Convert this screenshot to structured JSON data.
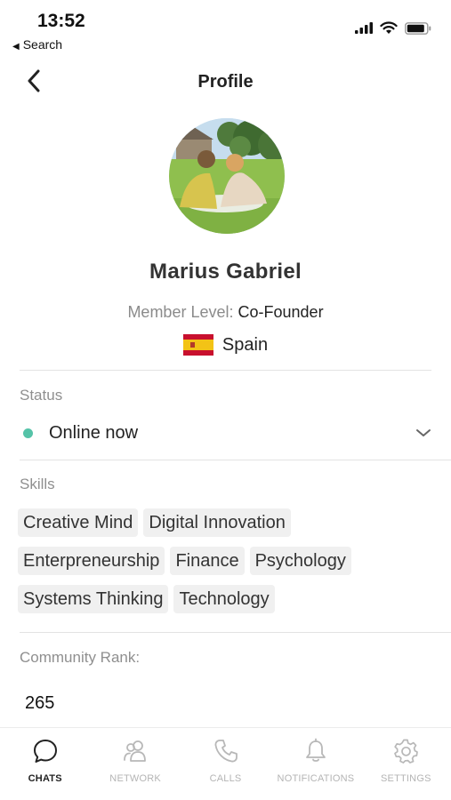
{
  "status_bar": {
    "time": "13:52",
    "back_app": "Search"
  },
  "nav": {
    "title": "Profile"
  },
  "profile": {
    "name": "Marius Gabriel",
    "member_level_label": "Member Level:",
    "member_level_value": "Co-Founder",
    "country": "Spain"
  },
  "status": {
    "label": "Status",
    "value": "Online now",
    "color": "#55c3a8"
  },
  "skills": {
    "label": "Skills",
    "items": [
      "Creative Mind",
      "Digital Innovation",
      "Enterpreneurship",
      "Finance",
      "Psychology",
      "Systems Thinking",
      "Technology"
    ]
  },
  "community": {
    "label": "Community Rank:",
    "value": "265"
  },
  "tabs": [
    {
      "label": "CHATS",
      "icon": "chat-bubble-icon",
      "active": true
    },
    {
      "label": "NETWORK",
      "icon": "network-icon",
      "active": false
    },
    {
      "label": "CALLS",
      "icon": "phone-icon",
      "active": false
    },
    {
      "label": "NOTIFICATIONS",
      "icon": "bell-icon",
      "active": false
    },
    {
      "label": "SETTINGS",
      "icon": "gear-icon",
      "active": false
    }
  ]
}
